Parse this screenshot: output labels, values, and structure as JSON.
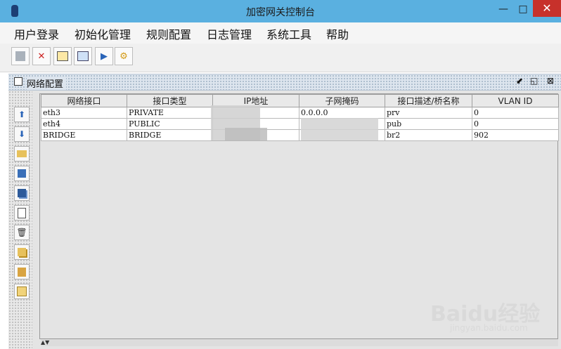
{
  "window": {
    "title": "加密网关控制台",
    "minimize": "—",
    "maximize": "□",
    "close": "✕"
  },
  "menu": [
    "用户登录",
    "初始化管理",
    "规则配置",
    "日志管理",
    "系统工具",
    "帮助"
  ],
  "toolbar": [
    "disk-icon",
    "delete-icon",
    "properties-icon",
    "form-icon",
    "forward-icon",
    "gear-icon"
  ],
  "panel": {
    "title": "网络配置",
    "restore": "⬋",
    "minimize": "◱",
    "close": "⊠"
  },
  "side_buttons": [
    "upload-icon",
    "download-icon",
    "folder-icon",
    "save-icon",
    "save-all-icon",
    "new-icon",
    "trash-icon",
    "copy-icon",
    "paste-icon",
    "list-icon"
  ],
  "table": {
    "columns": [
      "网络接口",
      "接口类型",
      "IP地址",
      "子网掩码",
      "接口描述/桥名称",
      "VLAN ID"
    ],
    "rows": [
      [
        "eth3",
        "PRIVATE",
        "",
        "0.0.0.0",
        "prv",
        "0"
      ],
      [
        "eth4",
        "PUBLIC",
        "",
        "",
        "pub",
        "0"
      ],
      [
        "BRIDGE",
        "BRIDGE",
        "",
        "",
        "br2",
        "902"
      ]
    ]
  },
  "scroll_arrows": "▲▼",
  "watermark": {
    "brand": "Baidu经验",
    "url": "jingyan.baidu.com"
  }
}
